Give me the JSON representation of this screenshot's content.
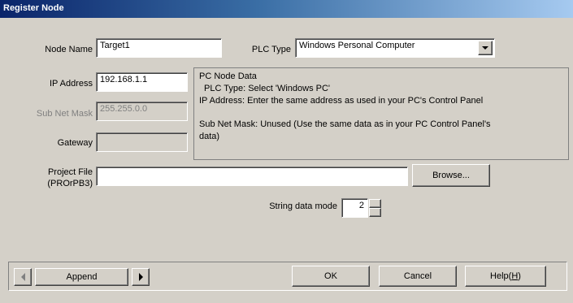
{
  "window": {
    "title": "Register Node"
  },
  "form": {
    "node_name_label": "Node Name",
    "node_name_value": "Target1",
    "plc_type_label": "PLC Type",
    "plc_type_value": "Windows Personal Computer",
    "ip_address_label": "IP Address",
    "ip_address_value": "192.168.1.1",
    "subnet_label": "Sub Net Mask",
    "subnet_value": "255.255.0.0",
    "gateway_label": "Gateway",
    "gateway_value": "",
    "project_file_label_1": "Project File",
    "project_file_label_2": "(PROrPB3)",
    "project_file_value": "",
    "browse_label": "Browse...",
    "string_mode_label": "String data mode",
    "string_mode_value": "2"
  },
  "info": {
    "heading": "PC Node Data",
    "line1": "PLC Type: Select 'Windows PC'",
    "line2": "IP Address: Enter the same address as used in your PC's Control Panel",
    "line3": "Sub Net Mask: Unused (Use the same data as in your PC Control Panel's",
    "line4": "data)"
  },
  "footer": {
    "append_label": "Append",
    "ok_label": "OK",
    "cancel_label": "Cancel",
    "help_label_main": "Help(",
    "help_label_key": "H",
    "help_label_end": ")"
  },
  "colors": {
    "dialog_bg": "#d4d0c8",
    "title_start": "#0a246a",
    "title_end": "#a6caf0"
  }
}
